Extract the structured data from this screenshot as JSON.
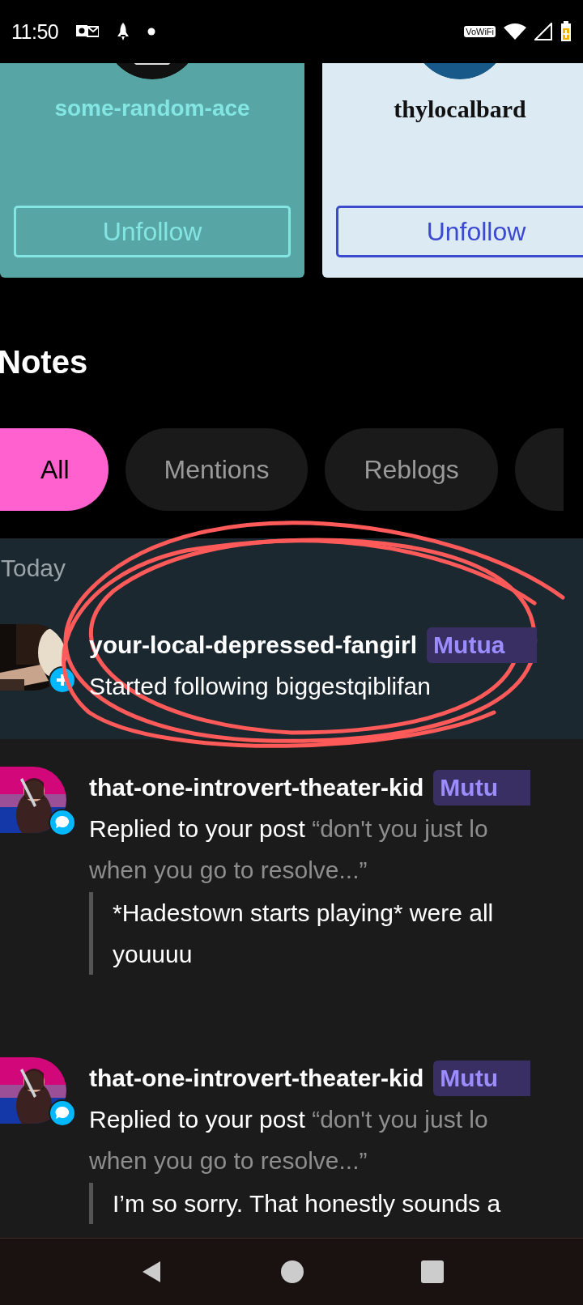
{
  "status_bar": {
    "time": "11:50",
    "vowifi": "VoWiFi"
  },
  "profiles": [
    {
      "kind": "teal",
      "name": "some-random-ace",
      "button": "Unfollow"
    },
    {
      "kind": "light",
      "name": "thylocalbard",
      "button": "Unfollow"
    }
  ],
  "notes": {
    "title": "Notes",
    "tabs": [
      {
        "label": "All",
        "selected": true
      },
      {
        "label": "Mentions",
        "selected": false
      },
      {
        "label": "Reblogs",
        "selected": false
      }
    ],
    "section": "Today",
    "items": [
      {
        "kind": "follow",
        "unread": true,
        "username": "your-local-depressed-fangirl",
        "badge": "Mutua",
        "action": "Started following biggestqiblifan"
      },
      {
        "kind": "reply",
        "unread": false,
        "username": "that-one-introvert-theater-kid",
        "badge": "Mutu",
        "action": "Replied to your post",
        "quote_lines": [
          "“don't you just lo",
          "when you go to resolve...”"
        ],
        "reply_lines": [
          "*Hadestown starts playing* were all",
          "youuuu"
        ]
      },
      {
        "kind": "reply",
        "unread": false,
        "username": "that-one-introvert-theater-kid",
        "badge": "Mutu",
        "action": "Replied to your post",
        "quote_lines": [
          "“don't you just lo",
          "when you go to resolve...”"
        ],
        "reply_lines": [
          "I’m so sorry. That honestly sounds a"
        ]
      }
    ]
  },
  "annotations": [
    {
      "kind": "ellipse",
      "color": "#ff5a5a"
    }
  ]
}
